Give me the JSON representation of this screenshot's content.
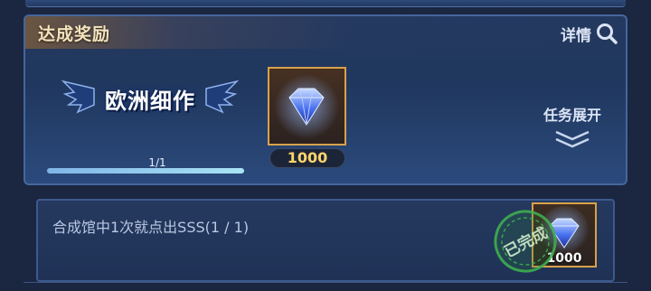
{
  "header": {
    "title": "达成奖励",
    "details_label": "详情"
  },
  "achievement": {
    "emblem_text": "欧洲细作",
    "progress_text": "1/1",
    "progress_fraction": 1.0
  },
  "reward": {
    "item_icon": "blue-diamond-icon",
    "quantity": "1000"
  },
  "expand": {
    "label": "任务展开"
  },
  "task": {
    "description": "合成馆中1次就点出SSS(1 / 1)",
    "stamp_text": "已完成",
    "reward_icon": "blue-diamond-icon",
    "reward_quantity": "1000"
  },
  "colors": {
    "accent_gold": "#d8a24a",
    "quantity_yellow": "#ffd56a",
    "stamp_green": "#3fae4f"
  }
}
